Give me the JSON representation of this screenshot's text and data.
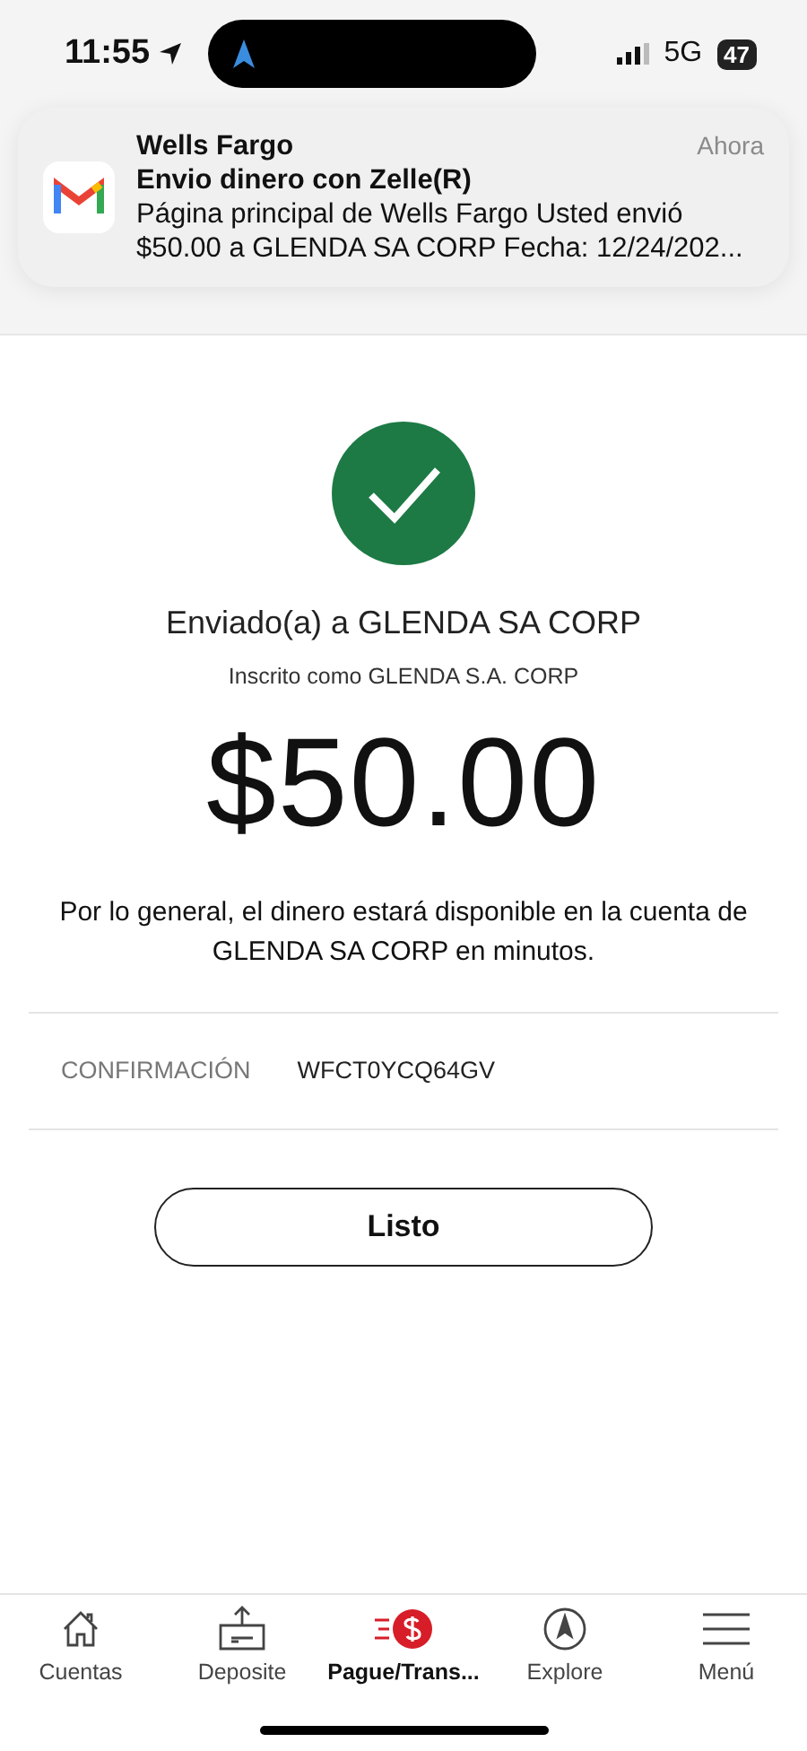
{
  "status_bar": {
    "time": "11:55",
    "network": "5G",
    "battery": "47"
  },
  "notification": {
    "app": "Wells Fargo",
    "time": "Ahora",
    "title": "Envio dinero con Zelle(R)",
    "body": "Página principal de Wells Fargo Usted envió $50.00 a GLENDA SA CORP Fecha: 12/24/202..."
  },
  "result": {
    "sent_to": "Enviado(a) a GLENDA SA CORP",
    "enrolled_as": "Inscrito como GLENDA S.A. CORP",
    "amount": "$50.00",
    "note": "Por lo general, el dinero estará disponible en la cuenta de GLENDA SA CORP en minutos."
  },
  "confirmation": {
    "label": "CONFIRMACIÓN",
    "value": "WFCT0YCQ64GV"
  },
  "done_button": "Listo",
  "tabs": [
    {
      "kind": "home",
      "label": "Cuentas",
      "selected": false
    },
    {
      "kind": "deposit",
      "label": "Deposite",
      "selected": false
    },
    {
      "kind": "pay",
      "label": "Pague/Trans...",
      "selected": true
    },
    {
      "kind": "explore",
      "label": "Explore",
      "selected": false
    },
    {
      "kind": "menu",
      "label": "Menú",
      "selected": false
    }
  ]
}
